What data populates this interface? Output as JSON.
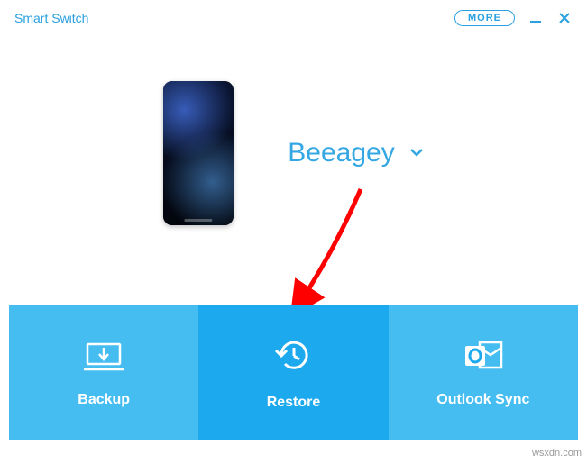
{
  "titlebar": {
    "app_title": "Smart Switch",
    "more_label": "MORE"
  },
  "device": {
    "name": "Beeagey"
  },
  "actions": {
    "backup": {
      "label": "Backup"
    },
    "restore": {
      "label": "Restore"
    },
    "outlook": {
      "label": "Outlook Sync"
    }
  },
  "colors": {
    "brand": "#2aa0e0",
    "tile_light": "#46bdf1",
    "tile_dark": "#1ca9ed",
    "annotation": "#ff0000"
  },
  "watermark": "wsxdn.com"
}
